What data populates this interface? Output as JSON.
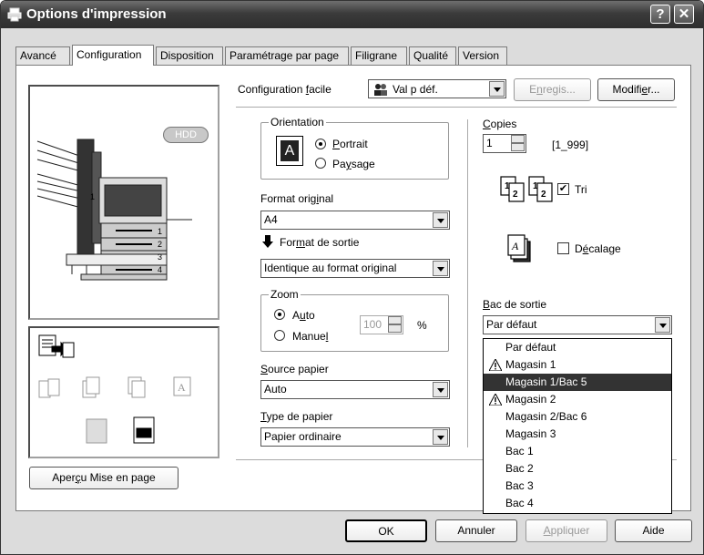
{
  "window": {
    "title": "Options d'impression",
    "help_btn": "?",
    "close_btn": "✕"
  },
  "tabs": [
    {
      "label": "Avancé"
    },
    {
      "label": "Configuration"
    },
    {
      "label": "Disposition"
    },
    {
      "label": "Paramétrage par page"
    },
    {
      "label": "Filigrane"
    },
    {
      "label": "Qualité"
    },
    {
      "label": "Version"
    }
  ],
  "preview": {
    "hdd_label": "HDD",
    "tray_numbers": [
      "1",
      "2",
      "3",
      "4"
    ],
    "side_tray_number": "1"
  },
  "apercu_button": {
    "pre": "Aper",
    "u": "ç",
    "post": "u Mise en page"
  },
  "config_facile": {
    "label_pre": "Configuration ",
    "label_u": "f",
    "label_post": "acile",
    "value": "Val p déf.",
    "enregis_pre": "E",
    "enregis_u": "n",
    "enregis_post": "regis...",
    "modifier_pre": "Modifi",
    "modifier_u": "e",
    "modifier_post": "r..."
  },
  "orientation": {
    "legend": "Orientation",
    "portrait_u": "P",
    "portrait_post": "ortrait",
    "paysage_pre": "Pa",
    "paysage_u": "y",
    "paysage_post": "sage",
    "glyph": "A"
  },
  "format_original": {
    "label_pre": "Format orig",
    "label_u": "i",
    "label_post": "nal",
    "value": "A4"
  },
  "format_sortie": {
    "label_pre": "For",
    "label_u": "m",
    "label_post": "at de sortie",
    "value": "Identique au format original"
  },
  "zoom": {
    "legend": "Zoom",
    "auto_pre": "A",
    "auto_u": "u",
    "auto_post": "to",
    "manuel_pre": "Manue",
    "manuel_u": "l",
    "manuel_post": "",
    "value": "100",
    "unit": "%"
  },
  "source_papier": {
    "label_u": "S",
    "label_post": "ource papier",
    "value": "Auto"
  },
  "type_papier": {
    "label_u": "T",
    "label_post": "ype de papier",
    "value": "Papier ordinaire"
  },
  "copies": {
    "label_u": "C",
    "label_post": "opies",
    "value": "1",
    "range": "[1_999]"
  },
  "tri": {
    "label": "Tri",
    "checked": "✔"
  },
  "decalage": {
    "label_pre": "D",
    "label_u": "é",
    "label_post": "calage"
  },
  "bac_sortie": {
    "label_u": "B",
    "label_post": "ac de sortie",
    "value": "Par défaut",
    "options": [
      {
        "label": "Par défaut",
        "warn": false
      },
      {
        "label": "Magasin 1",
        "warn": true
      },
      {
        "label": "Magasin 1/Bac 5",
        "warn": false,
        "selected": true
      },
      {
        "label": "Magasin 2",
        "warn": true
      },
      {
        "label": "Magasin 2/Bac 6",
        "warn": false
      },
      {
        "label": "Magasin 3",
        "warn": false
      },
      {
        "label": "Bac 1",
        "warn": false
      },
      {
        "label": "Bac 2",
        "warn": false
      },
      {
        "label": "Bac 3",
        "warn": false
      },
      {
        "label": "Bac 4",
        "warn": false
      }
    ]
  },
  "footer": {
    "ok": "OK",
    "annuler": "Annuler",
    "appliquer_u": "A",
    "appliquer_post": "ppliquer",
    "aide": "Aide"
  }
}
